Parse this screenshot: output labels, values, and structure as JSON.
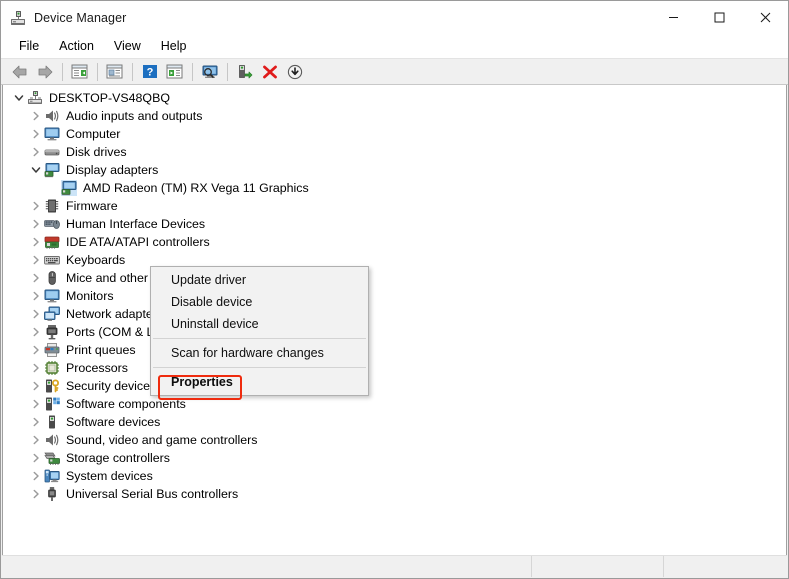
{
  "window": {
    "title": "Device Manager",
    "icon": "device-manager-icon",
    "buttons": {
      "minimize": "—",
      "maximize": "□",
      "close": "✕"
    }
  },
  "menubar": {
    "items": [
      {
        "label": "File",
        "name": "menu-file"
      },
      {
        "label": "Action",
        "name": "menu-action"
      },
      {
        "label": "View",
        "name": "menu-view"
      },
      {
        "label": "Help",
        "name": "menu-help"
      }
    ]
  },
  "toolbar": {
    "buttons": [
      {
        "name": "back-icon",
        "title": "Back"
      },
      {
        "name": "forward-icon",
        "title": "Forward"
      },
      {
        "name": "show-hide-console-tree-icon",
        "title": "Show/Hide Console Tree"
      },
      {
        "name": "properties-icon",
        "title": "Properties"
      },
      {
        "name": "help-icon",
        "title": "Help"
      },
      {
        "name": "update-driver-icon",
        "title": "Update Driver Software"
      },
      {
        "name": "display-icon",
        "title": "Scan for hardware changes"
      },
      {
        "name": "enable-device-icon",
        "title": "Enable device"
      },
      {
        "name": "uninstall-device-icon",
        "title": "Uninstall device"
      },
      {
        "name": "scan-hardware-icon",
        "title": "Scan for hardware changes"
      }
    ]
  },
  "tree": {
    "root": {
      "label": "DESKTOP-VS48QBQ",
      "icon": "computer-root-icon",
      "expanded": true
    },
    "items": [
      {
        "label": "Audio inputs and outputs",
        "icon": "speaker-icon",
        "expanded": false,
        "indent": 1,
        "selected": false
      },
      {
        "label": "Computer",
        "icon": "monitor-icon",
        "expanded": false,
        "indent": 1,
        "selected": false
      },
      {
        "label": "Disk drives",
        "icon": "disk-icon",
        "expanded": false,
        "indent": 1,
        "selected": false
      },
      {
        "label": "Display adapters",
        "icon": "display-adapter-icon",
        "expanded": true,
        "indent": 1,
        "selected": false
      },
      {
        "label": "AMD Radeon (TM) RX Vega 11 Graphics",
        "icon": "display-adapter-icon",
        "expanded": null,
        "indent": 2,
        "selected": true
      },
      {
        "label": "Firmware",
        "icon": "firmware-chip-icon",
        "expanded": false,
        "indent": 1,
        "selected": false
      },
      {
        "label": "Human Interface Devices",
        "icon": "hid-icon",
        "expanded": false,
        "indent": 1,
        "selected": false
      },
      {
        "label": "IDE ATA/ATAPI controllers",
        "icon": "ide-controller-icon",
        "expanded": false,
        "indent": 1,
        "selected": false
      },
      {
        "label": "Keyboards",
        "icon": "keyboard-icon",
        "expanded": false,
        "indent": 1,
        "selected": false
      },
      {
        "label": "Mice and other pointing devices",
        "icon": "mouse-icon",
        "expanded": false,
        "indent": 1,
        "selected": false
      },
      {
        "label": "Monitors",
        "icon": "monitor-icon",
        "expanded": false,
        "indent": 1,
        "selected": false
      },
      {
        "label": "Network adapters",
        "icon": "network-adapter-icon",
        "expanded": false,
        "indent": 1,
        "selected": false
      },
      {
        "label": "Ports (COM & LPT)",
        "icon": "port-icon",
        "expanded": false,
        "indent": 1,
        "selected": false
      },
      {
        "label": "Print queues",
        "icon": "printer-icon",
        "expanded": false,
        "indent": 1,
        "selected": false
      },
      {
        "label": "Processors",
        "icon": "processor-icon",
        "expanded": false,
        "indent": 1,
        "selected": false
      },
      {
        "label": "Security devices",
        "icon": "security-device-icon",
        "expanded": false,
        "indent": 1,
        "selected": false
      },
      {
        "label": "Software components",
        "icon": "software-component-icon",
        "expanded": false,
        "indent": 1,
        "selected": false
      },
      {
        "label": "Software devices",
        "icon": "software-device-icon",
        "expanded": false,
        "indent": 1,
        "selected": false
      },
      {
        "label": "Sound, video and game controllers",
        "icon": "speaker-icon",
        "expanded": false,
        "indent": 1,
        "selected": false
      },
      {
        "label": "Storage controllers",
        "icon": "storage-controller-icon",
        "expanded": false,
        "indent": 1,
        "selected": false
      },
      {
        "label": "System devices",
        "icon": "system-device-icon",
        "expanded": false,
        "indent": 1,
        "selected": false
      },
      {
        "label": "Universal Serial Bus controllers",
        "icon": "usb-icon",
        "expanded": false,
        "indent": 1,
        "selected": false
      }
    ]
  },
  "context_menu": {
    "items": [
      {
        "label": "Update driver",
        "bold": false,
        "highlighted": false
      },
      {
        "label": "Disable device",
        "bold": false,
        "highlighted": false
      },
      {
        "label": "Uninstall device",
        "bold": false,
        "highlighted": false
      },
      {
        "separator": true
      },
      {
        "label": "Scan for hardware changes",
        "bold": false,
        "highlighted": false
      },
      {
        "separator": true
      },
      {
        "label": "Properties",
        "bold": true,
        "highlighted": true
      }
    ]
  },
  "annotation": {
    "highlight_color": "#ef2b0e",
    "target": "Properties"
  },
  "colors": {
    "selection": "#cce4f7",
    "titlebar": "#ffffff",
    "toolbar": "#f0f0f0",
    "menu_bg": "#f2f2f2"
  },
  "statusbar": {
    "pane1": "",
    "pane2": "",
    "pane3": ""
  }
}
